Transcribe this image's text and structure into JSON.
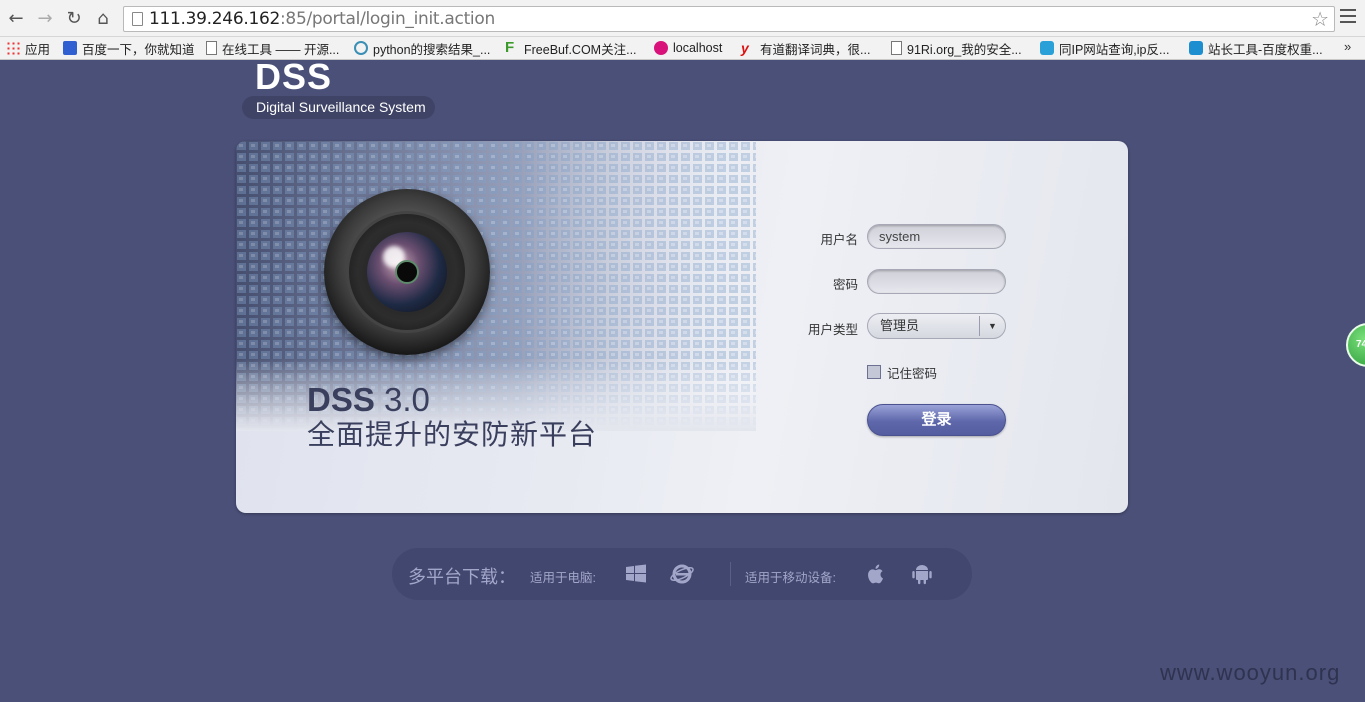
{
  "browser": {
    "url_host": "111.39.246.162",
    "url_rest": ":85/portal/login_init.action",
    "bookmarks": [
      {
        "label": "应用",
        "icon": "apps-grid-icon"
      },
      {
        "label": "百度一下，你就知道",
        "icon": "baidu-paw-icon"
      },
      {
        "label": "在线工具 —— 开源...",
        "icon": "page-icon"
      },
      {
        "label": "python的搜索结果_...",
        "icon": "play-circle-icon"
      },
      {
        "label": "FreeBuf.COM关注...",
        "icon": "freebuf-f-icon"
      },
      {
        "label": "localhost",
        "icon": "localhost-icon"
      },
      {
        "label": "有道翻译词典，很...",
        "icon": "youdao-y-icon"
      },
      {
        "label": "91Ri.org_我的安全...",
        "icon": "page-icon"
      },
      {
        "label": "同IP网站查询,ip反...",
        "icon": "ip-query-icon"
      },
      {
        "label": "站长工具-百度权重...",
        "icon": "chinaz-icon"
      }
    ],
    "more": "»"
  },
  "header": {
    "logo_title": "DSS",
    "logo_subtitle": "Digital Surveillance System"
  },
  "panel": {
    "product": "DSS",
    "version": "3.0",
    "slogan": "全面提升的安防新平台"
  },
  "form": {
    "username_label": "用户名",
    "username_value": "system",
    "password_label": "密码",
    "password_value": "",
    "usertype_label": "用户类型",
    "usertype_value": "管理员",
    "remember_label": "记住密码",
    "remember_checked": false,
    "login_label": "登录"
  },
  "download": {
    "title": "多平台下载：",
    "pc_label": "适用于电脑:",
    "mobile_label": "适用于移动设备:"
  },
  "side_badge": "74",
  "watermark": "www.wooyun.org",
  "colors": {
    "page_bg": "#4a5078",
    "download_bar": "#424770",
    "login_button": "#5e67aa",
    "headline_text": "#3a3f5e"
  }
}
